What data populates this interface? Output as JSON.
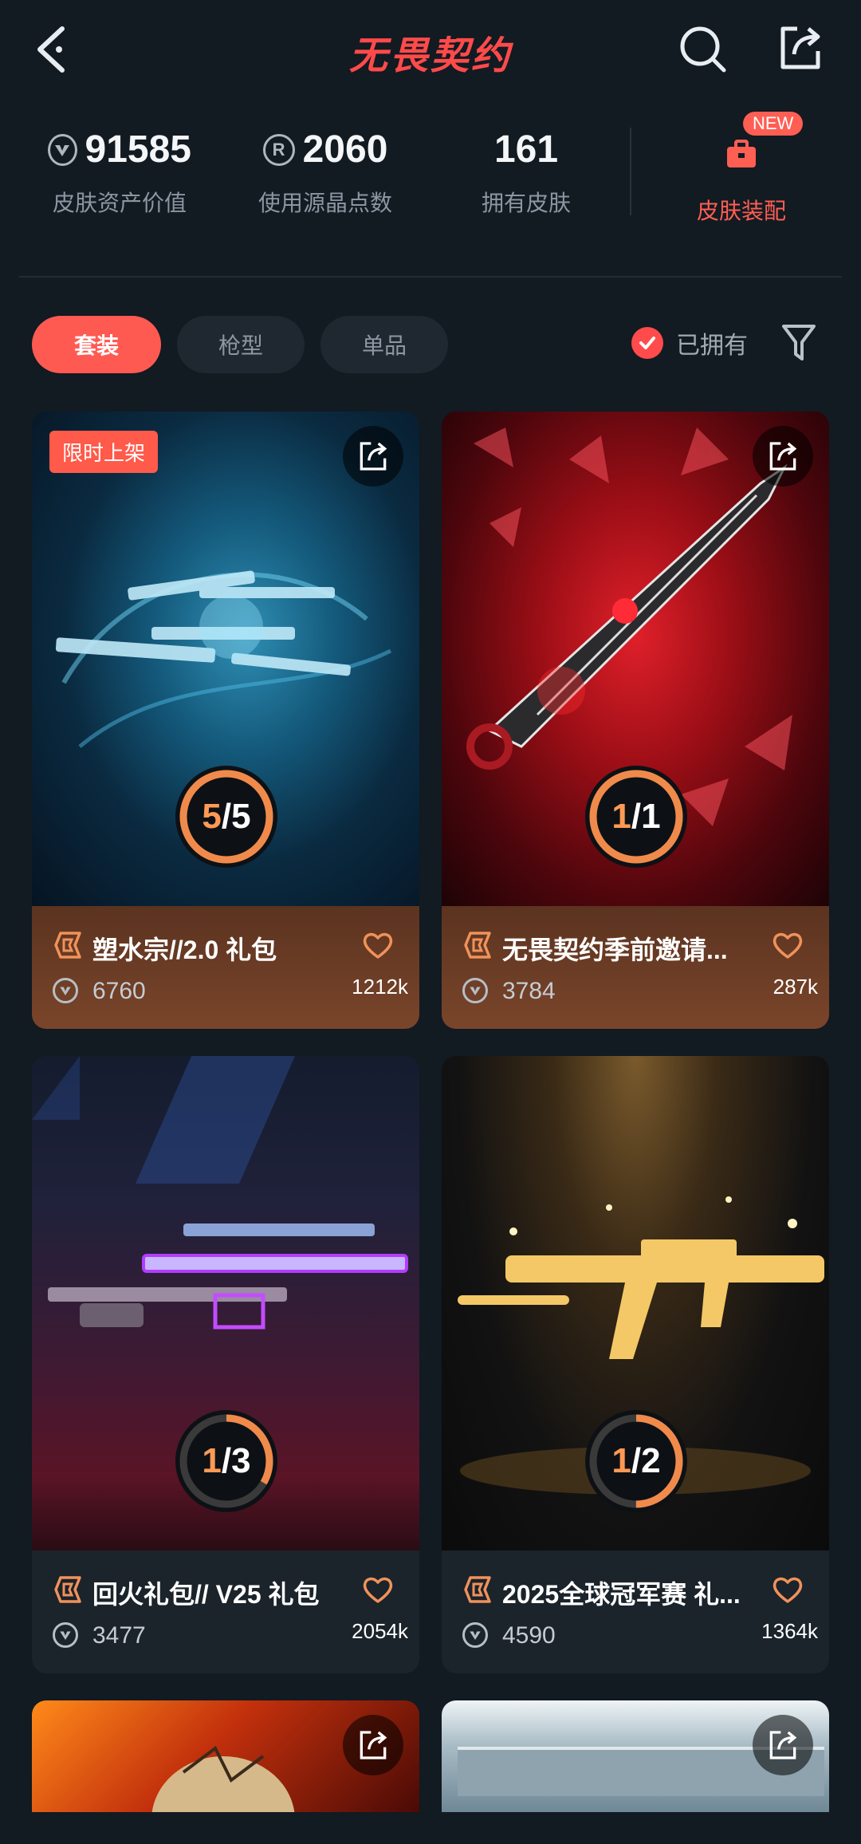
{
  "header": {
    "title": "无畏契约"
  },
  "stats": [
    {
      "value": "91585",
      "label": "皮肤资产价值",
      "icon": "vp-coin-icon"
    },
    {
      "value": "2060",
      "label": "使用源晶点数",
      "icon": "radianite-icon"
    },
    {
      "value": "161",
      "label": "拥有皮肤"
    }
  ],
  "equip": {
    "label": "皮肤装配",
    "badge": "NEW"
  },
  "filters": {
    "tabs": [
      "套装",
      "枪型",
      "单品"
    ],
    "owned_label": "已拥有"
  },
  "cards": [
    {
      "name": "塑水宗//2.0 礼包",
      "price": "6760",
      "likes": "1212k",
      "owned": "5",
      "total": "5",
      "badge": "限时上架"
    },
    {
      "name": "无畏契约季前邀请...",
      "price": "3784",
      "likes": "287k",
      "owned": "1",
      "total": "1"
    },
    {
      "name": "回火礼包// V25 礼包",
      "price": "3477",
      "likes": "2054k",
      "owned": "1",
      "total": "3"
    },
    {
      "name": "2025全球冠军赛 礼...",
      "price": "4590",
      "likes": "1364k",
      "owned": "1",
      "total": "2"
    }
  ],
  "colors": {
    "accent": "#ff5a52",
    "background": "#121a22",
    "ring": "#f08a4b"
  }
}
